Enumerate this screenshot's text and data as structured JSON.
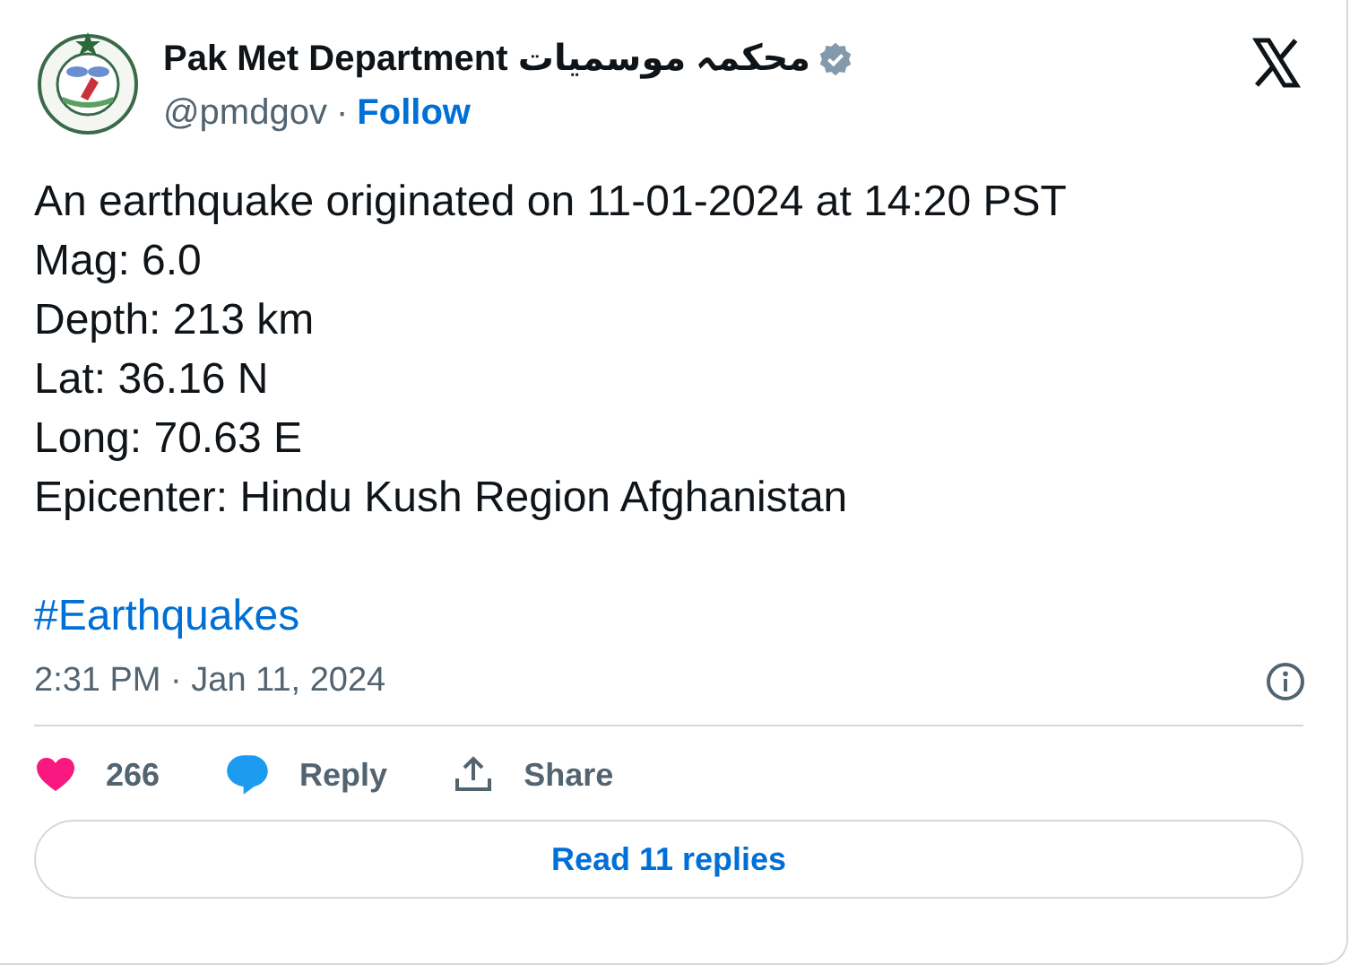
{
  "author": {
    "name": "Pak Met Department محکمہ موسمیات",
    "verified": true,
    "handle": "@pmdgov",
    "separator": "·",
    "follow": "Follow"
  },
  "body": [
    "An earthquake originated on 11-01-2024 at 14:20 PST",
    "Mag: 6.0",
    "Depth: 213 km",
    "Lat: 36.16 N",
    "Long: 70.63 E",
    "Epicenter: Hindu Kush Region Afghanistan"
  ],
  "hashtag": "#Earthquakes",
  "timestamp": "2:31 PM · Jan 11, 2024",
  "actions": [
    {
      "kind": "like",
      "label": "266"
    },
    {
      "kind": "reply",
      "label": "Reply"
    },
    {
      "kind": "share",
      "label": "Share"
    }
  ],
  "read_replies": "Read 11 replies"
}
